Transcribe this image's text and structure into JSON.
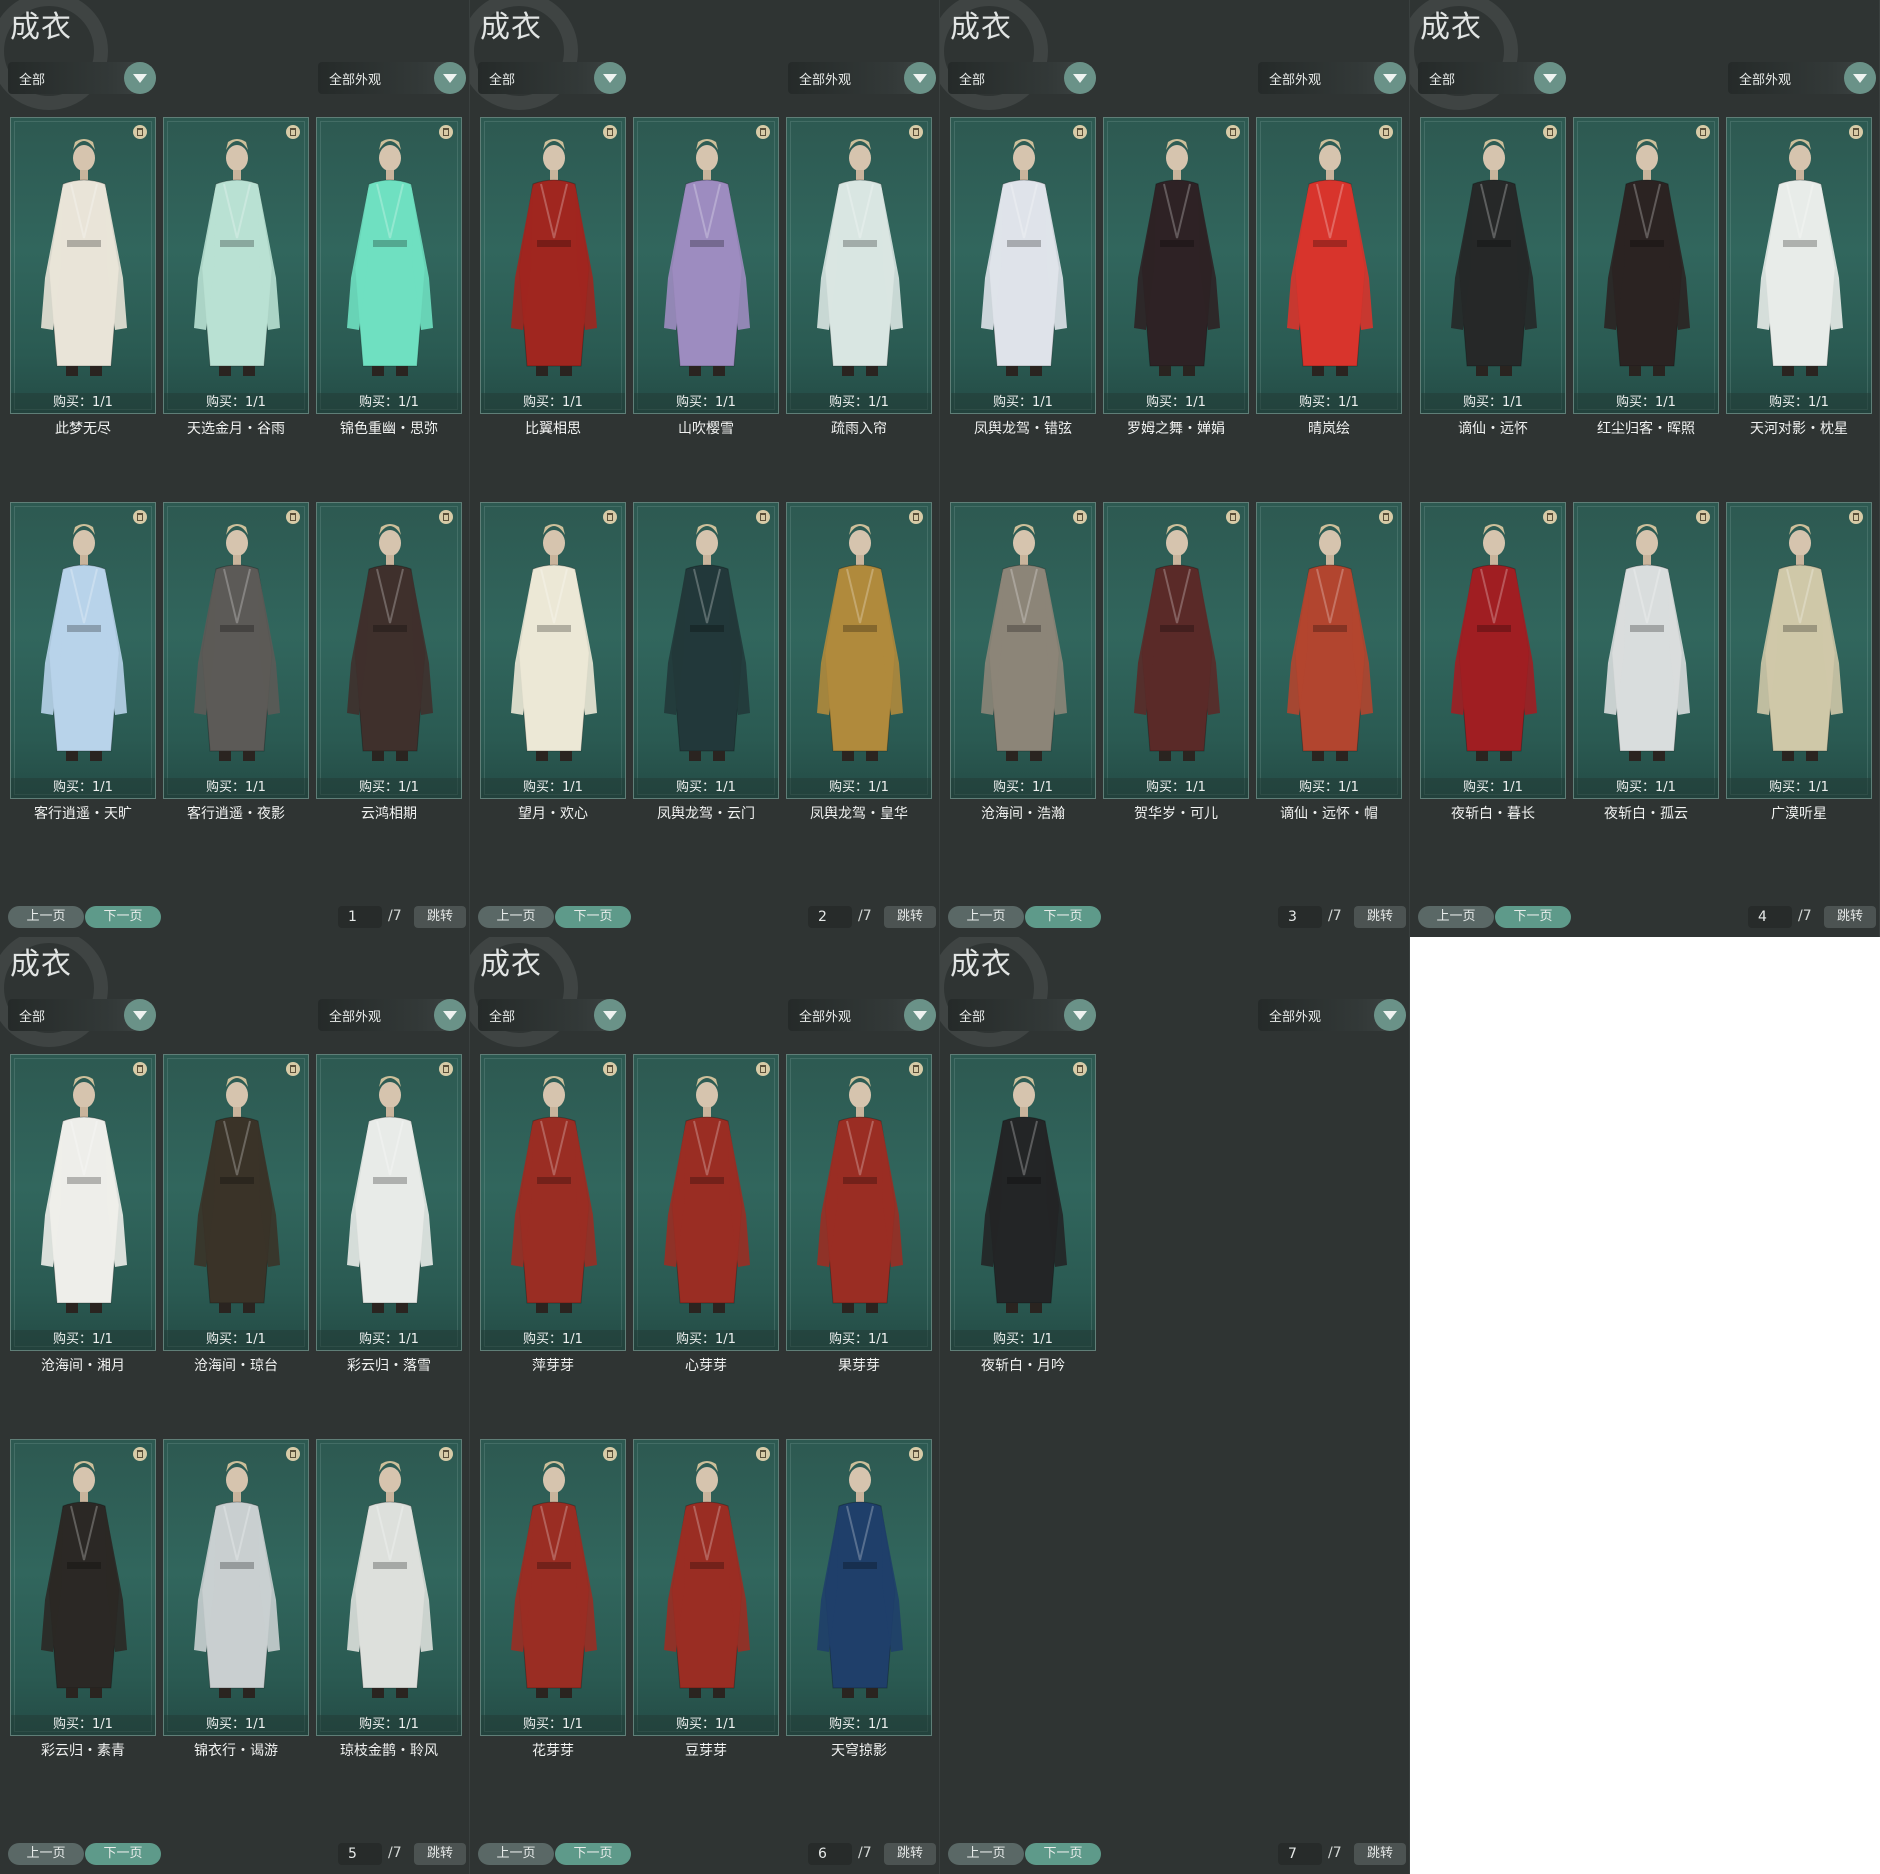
{
  "panels": [
    {
      "title": "成衣",
      "filter1": "全部",
      "filter2": "全部外观",
      "prev": "上一页",
      "next": "下一页",
      "page": "1",
      "total": "/7",
      "jump": "跳转",
      "items": [
        {
          "buy": "购买：1/1",
          "name": "此梦无尽",
          "color": "#e9e4d8"
        },
        {
          "buy": "购买：1/1",
          "name": "天选金月・谷雨",
          "color": "#b9e1d3"
        },
        {
          "buy": "购买：1/1",
          "name": "锦色重幽・思弥",
          "color": "#6fe0c1"
        },
        {
          "buy": "购买：1/1",
          "name": "客行逍遥・天旷",
          "color": "#b8d3ea"
        },
        {
          "buy": "购买：1/1",
          "name": "客行逍遥・夜影",
          "color": "#5c5a57"
        },
        {
          "buy": "购买：1/1",
          "name": "云鸿相期",
          "color": "#3f302c"
        }
      ]
    },
    {
      "title": "成衣",
      "filter1": "全部",
      "filter2": "全部外观",
      "prev": "上一页",
      "next": "下一页",
      "page": "2",
      "total": "/7",
      "jump": "跳转",
      "items": [
        {
          "buy": "购买：1/1",
          "name": "比翼相思",
          "color": "#a0261f"
        },
        {
          "buy": "购买：1/1",
          "name": "山吹樱雪",
          "color": "#9d8cc0"
        },
        {
          "buy": "购买：1/1",
          "name": "疏雨入帘",
          "color": "#d9e6e2"
        },
        {
          "buy": "购买：1/1",
          "name": "望月・欢心",
          "color": "#ece8d6"
        },
        {
          "buy": "购买：1/1",
          "name": "凤舆龙驾・云门",
          "color": "#22383a"
        },
        {
          "buy": "购买：1/1",
          "name": "凤舆龙驾・皇华",
          "color": "#b08a3c"
        }
      ]
    },
    {
      "title": "成衣",
      "filter1": "全部",
      "filter2": "全部外观",
      "prev": "上一页",
      "next": "下一页",
      "page": "3",
      "total": "/7",
      "jump": "跳转",
      "items": [
        {
          "buy": "购买：1/1",
          "name": "凤舆龙驾・错弦",
          "color": "#dfe3ea"
        },
        {
          "buy": "购买：1/1",
          "name": "罗姆之舞・婵娟",
          "color": "#2e2225"
        },
        {
          "buy": "购买：1/1",
          "name": "晴岚绘",
          "color": "#d8342c"
        },
        {
          "buy": "购买：1/1",
          "name": "沧海间・浩瀚",
          "color": "#8c8578"
        },
        {
          "buy": "购买：1/1",
          "name": "贺华岁・可儿",
          "color": "#5a2a28"
        },
        {
          "buy": "购买：1/1",
          "name": "谪仙・远怀・帽",
          "color": "#b2452f"
        }
      ]
    },
    {
      "title": "成衣",
      "filter1": "全部",
      "filter2": "全部外观",
      "prev": "上一页",
      "next": "下一页",
      "page": "4",
      "total": "/7",
      "jump": "跳转",
      "items": [
        {
          "buy": "购买：1/1",
          "name": "谪仙・远怀",
          "color": "#262828"
        },
        {
          "buy": "购买：1/1",
          "name": "红尘归客・晖照",
          "color": "#2b2322"
        },
        {
          "buy": "购买：1/1",
          "name": "天河对影・枕星",
          "color": "#e8ece9"
        },
        {
          "buy": "购买：1/1",
          "name": "夜斩白・暮长",
          "color": "#a01e22"
        },
        {
          "buy": "购买：1/1",
          "name": "夜斩白・孤云",
          "color": "#d9dddd"
        },
        {
          "buy": "购买：1/1",
          "name": "广漠听星",
          "color": "#cfc8a8"
        }
      ]
    },
    {
      "title": "成衣",
      "filter1": "全部",
      "filter2": "全部外观",
      "prev": "上一页",
      "next": "下一页",
      "page": "5",
      "total": "/7",
      "jump": "跳转",
      "items": [
        {
          "buy": "购买：1/1",
          "name": "沧海间・湘月",
          "color": "#eeeeea"
        },
        {
          "buy": "购买：1/1",
          "name": "沧海间・琼台",
          "color": "#3a3328"
        },
        {
          "buy": "购买：1/1",
          "name": "彩云归・落雪",
          "color": "#e8ebe8"
        },
        {
          "buy": "购买：1/1",
          "name": "彩云归・素青",
          "color": "#2b2825"
        },
        {
          "buy": "购买：1/1",
          "name": "锦衣行・谒游",
          "color": "#c9cfd0"
        },
        {
          "buy": "购买：1/1",
          "name": "琼枝金鹊・聆风",
          "color": "#dde0dc"
        }
      ]
    },
    {
      "title": "成衣",
      "filter1": "全部",
      "filter2": "全部外观",
      "prev": "上一页",
      "next": "下一页",
      "page": "6",
      "total": "/7",
      "jump": "跳转",
      "items": [
        {
          "buy": "购买：1/1",
          "name": "萍芽芽",
          "color": "#9a2d23"
        },
        {
          "buy": "购买：1/1",
          "name": "心芽芽",
          "color": "#9a2d23"
        },
        {
          "buy": "购买：1/1",
          "name": "果芽芽",
          "color": "#9a2d23"
        },
        {
          "buy": "购买：1/1",
          "name": "花芽芽",
          "color": "#9a2d23"
        },
        {
          "buy": "购买：1/1",
          "name": "豆芽芽",
          "color": "#9a2d23"
        },
        {
          "buy": "购买：1/1",
          "name": "天穹掠影",
          "color": "#1f3f6a"
        }
      ]
    },
    {
      "title": "成衣",
      "filter1": "全部",
      "filter2": "全部外观",
      "prev": "上一页",
      "next": "下一页",
      "page": "7",
      "total": "/7",
      "jump": "跳转",
      "items": [
        {
          "buy": "购买：1/1",
          "name": "夜斩白・月吟",
          "color": "#232526"
        }
      ]
    }
  ]
}
